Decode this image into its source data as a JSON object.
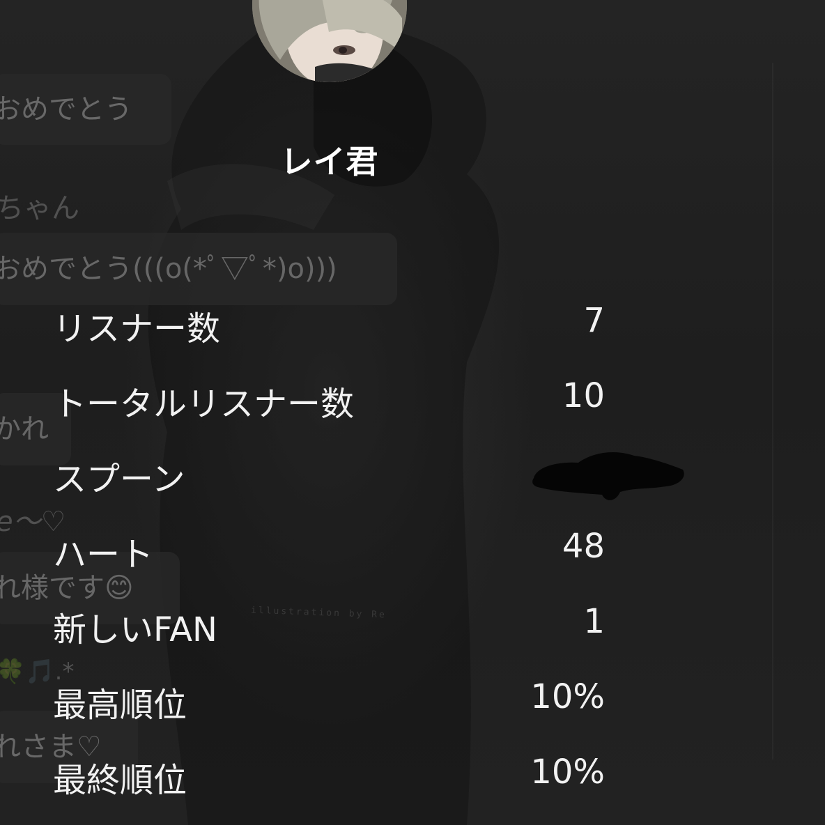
{
  "profile": {
    "username": "レイ君"
  },
  "background_chat": {
    "bubble_1": "おめでとう",
    "line_2": "ちゃん",
    "bubble_3": "おめでとう(((o(*ﾟ▽ﾟ*)o)))",
    "bubble_4": "かれ",
    "line_5": "e～♡",
    "bubble_6": "れ様です😊",
    "line_7": "🍀🎵.*",
    "bubble_8": "れさま♡"
  },
  "watermark": "illustration by Re",
  "stats": [
    {
      "label": "リスナー数",
      "value": "7"
    },
    {
      "label": "トータルリスナー数",
      "value": "10"
    },
    {
      "label": "スプーン",
      "value": ""
    },
    {
      "label": "ハート",
      "value": "48"
    },
    {
      "label": "新しいFAN",
      "value": "1"
    },
    {
      "label": "最高順位",
      "value": "10%"
    },
    {
      "label": "最終順位",
      "value": "10%"
    }
  ],
  "colors": {
    "background": "#1d1d1d",
    "text": "#f2f2f2",
    "bubble": "#282828"
  }
}
